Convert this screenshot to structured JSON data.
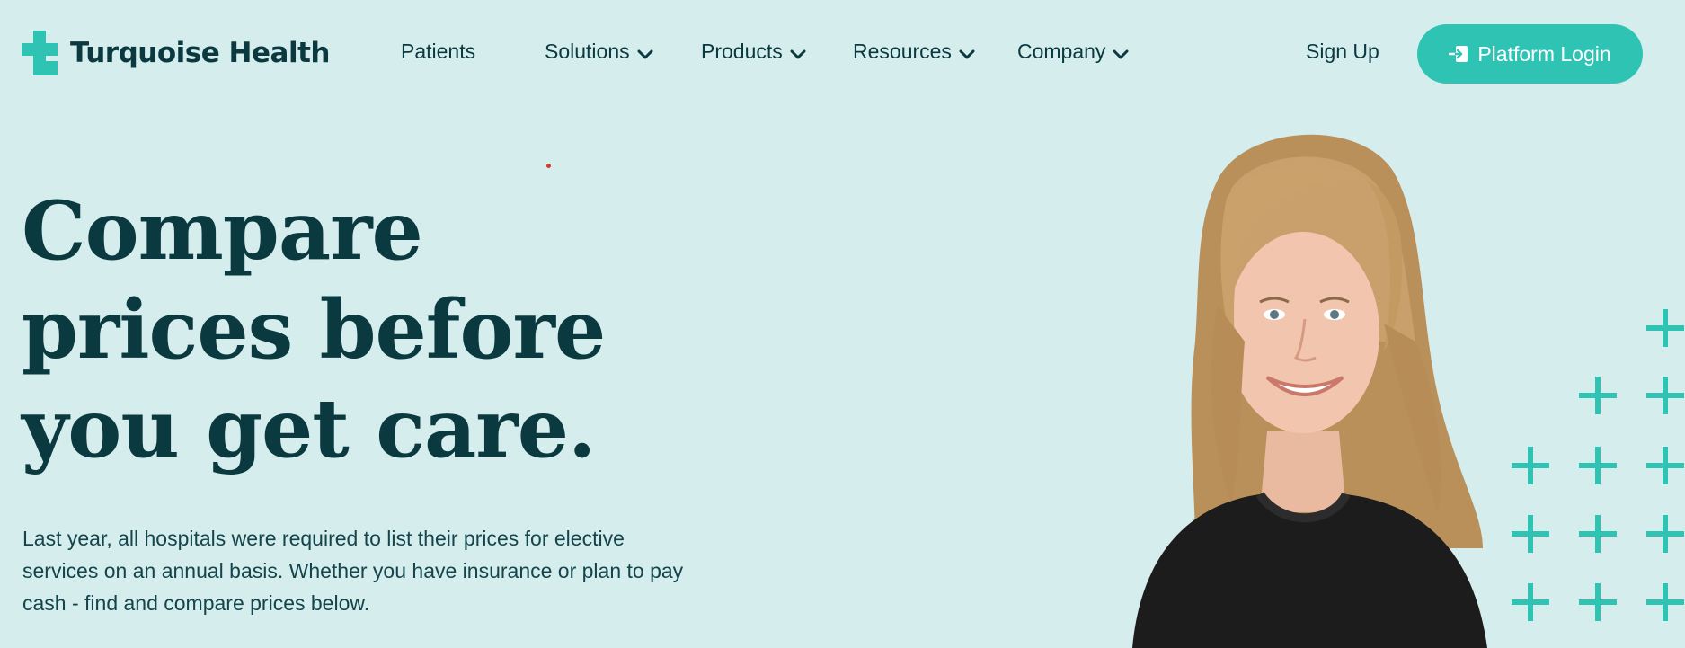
{
  "brand": {
    "name": "Turquoise Health",
    "accent_color": "#2fc3b4",
    "text_color": "#0b3940",
    "background_color": "#d5edec"
  },
  "header": {
    "nav": [
      {
        "label": "Patients",
        "has_dropdown": false
      },
      {
        "label": "Solutions",
        "has_dropdown": true
      },
      {
        "label": "Products",
        "has_dropdown": true
      },
      {
        "label": "Resources",
        "has_dropdown": true
      },
      {
        "label": "Company",
        "has_dropdown": true
      }
    ],
    "signup_label": "Sign Up",
    "login_label": "Platform Login",
    "login_icon": "login-arrow-icon"
  },
  "hero": {
    "title_lines": [
      "Compare",
      "prices before",
      "you get care."
    ],
    "description": "Last year, all hospitals were required to list their prices for elective services on an annual basis. Whether you have insurance or plan to pay cash - find and compare prices below.",
    "portrait": "smiling-woman-portrait"
  }
}
